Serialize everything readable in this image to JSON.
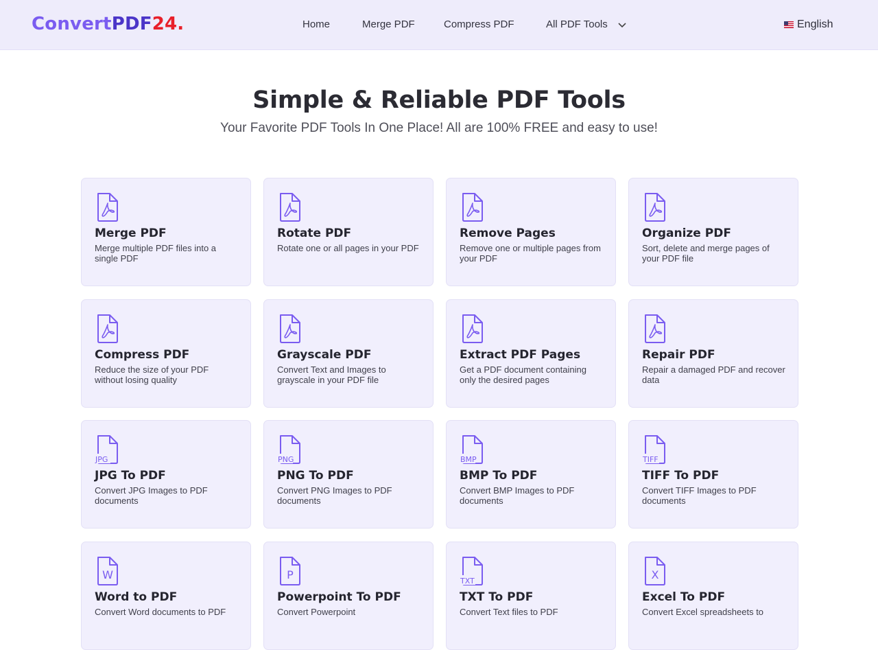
{
  "header": {
    "logo": {
      "part1": "Convert",
      "part2": "PDF",
      "part3": "24",
      "part4": "."
    },
    "nav": [
      {
        "label": "Home"
      },
      {
        "label": "Merge PDF"
      },
      {
        "label": "Compress PDF"
      },
      {
        "label": "All PDF Tools",
        "icon": "chevron-down-icon"
      }
    ],
    "language": {
      "label": "English",
      "icon": "us-flag-icon"
    }
  },
  "hero": {
    "title": "Simple & Reliable PDF Tools",
    "subtitle": "Your Favorite PDF Tools In One Place! All are 100% FREE and easy to use!"
  },
  "tools": [
    {
      "title": "Merge PDF",
      "desc": "Merge multiple PDF files into a single PDF",
      "icon": "pdf-file-icon"
    },
    {
      "title": "Rotate PDF",
      "desc": "Rotate one or all pages in your PDF",
      "icon": "pdf-file-icon"
    },
    {
      "title": "Remove Pages",
      "desc": "Remove one or multiple pages from your PDF",
      "icon": "pdf-file-icon"
    },
    {
      "title": "Organize PDF",
      "desc": "Sort, delete and merge pages of your PDF file",
      "icon": "pdf-file-icon"
    },
    {
      "title": "Compress PDF",
      "desc": "Reduce the size of your PDF without losing quality",
      "icon": "pdf-file-icon"
    },
    {
      "title": "Grayscale PDF",
      "desc": "Convert Text and Images to grayscale in your PDF file",
      "icon": "pdf-file-icon"
    },
    {
      "title": "Extract PDF Pages",
      "desc": "Get a PDF document containing only the desired pages",
      "icon": "pdf-file-icon"
    },
    {
      "title": "Repair PDF",
      "desc": "Repair a damaged PDF and recover data",
      "icon": "pdf-file-icon"
    },
    {
      "title": "JPG To PDF",
      "desc": "Convert JPG Images to PDF documents",
      "icon": "jpg-file-icon",
      "badge": "JPG"
    },
    {
      "title": "PNG To PDF",
      "desc": "Convert PNG Images to PDF documents",
      "icon": "png-file-icon",
      "badge": "PNG"
    },
    {
      "title": "BMP To PDF",
      "desc": "Convert BMP Images to PDF documents",
      "icon": "bmp-file-icon",
      "badge": "BMP"
    },
    {
      "title": "TIFF To PDF",
      "desc": "Convert TIFF Images to PDF documents",
      "icon": "tiff-file-icon",
      "badge": "TIFF"
    },
    {
      "title": "Word to PDF",
      "desc": "Convert Word documents to PDF",
      "icon": "word-file-icon",
      "badge": "W"
    },
    {
      "title": "Powerpoint To PDF",
      "desc": "Convert Powerpoint",
      "icon": "powerpoint-file-icon",
      "badge": "P"
    },
    {
      "title": "TXT To PDF",
      "desc": "Convert Text files to PDF",
      "icon": "txt-file-icon",
      "badge": "TXT"
    },
    {
      "title": "Excel To PDF",
      "desc": "Convert Excel spreadsheets to",
      "icon": "excel-file-icon",
      "badge": "X"
    }
  ],
  "colors": {
    "accent": "#7a5cf0",
    "logo_dark": "#4b35c8",
    "logo_red": "#e8202a",
    "card_bg": "#f1effd",
    "header_bg": "#eeecfb"
  }
}
